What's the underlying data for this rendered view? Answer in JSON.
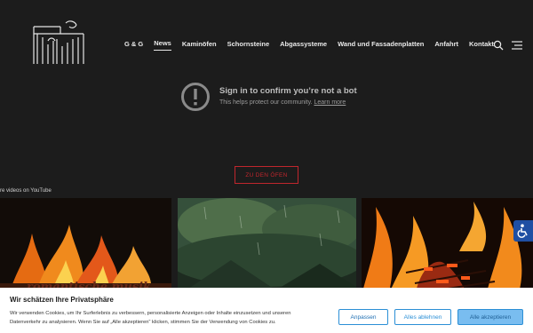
{
  "header": {
    "nav": [
      {
        "label": "G & G",
        "active": false
      },
      {
        "label": "News",
        "active": true
      },
      {
        "label": "Kaminöfen",
        "active": false
      },
      {
        "label": "Schornsteine",
        "active": false
      },
      {
        "label": "Abgassysteme",
        "active": false
      },
      {
        "label": "Wand und Fassadenplatten",
        "active": false
      },
      {
        "label": "Anfahrt",
        "active": false
      },
      {
        "label": "Kontakt",
        "active": false
      }
    ],
    "icons": [
      "logo",
      "search-icon",
      "menu-icon"
    ]
  },
  "youtube": {
    "title": "Sign in to confirm you’re not a bot",
    "subtitle": "This helps protect our community.",
    "learn_more": "Learn more",
    "more_videos": "re videos on YouTube",
    "video_overlay_text": "romantische musik"
  },
  "cta": {
    "label": "ZU DEN ÖFEN"
  },
  "cookie": {
    "title": "Wir schätzen Ihre Privatsphäre",
    "text": "Wir verwenden Cookies, um Ihr Surferlebnis zu verbessern, personalisierte Anzeigen oder Inhalte einzusetzen und unseren Datenverkehr zu analysieren. Wenn Sie auf „Alle akzeptieren“ klicken, stimmen Sie der Verwendung von Cookies zu.",
    "adjust": "Anpassen",
    "reject": "Alles ablehnen",
    "accept": "Alle akzeptieren"
  },
  "colors": {
    "accent_red": "#c0262d",
    "cookie_blue": "#2b8fd6",
    "a11y_blue": "#1f4fa3"
  }
}
